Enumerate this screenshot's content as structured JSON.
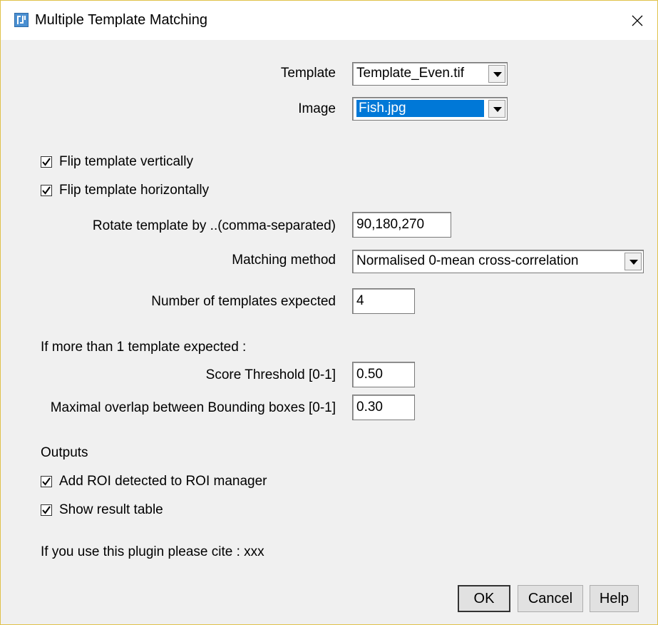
{
  "window": {
    "title": "Multiple Template Matching"
  },
  "fields": {
    "template_label": "Template",
    "template_value": "Template_Even.tif",
    "image_label": "Image",
    "image_value": "Fish.jpg",
    "flip_v_label": "Flip template vertically",
    "flip_v_checked": true,
    "flip_h_label": "Flip template horizontally",
    "flip_h_checked": true,
    "rotate_label": "Rotate template by ..(comma-separated)",
    "rotate_value": "90,180,270",
    "method_label": "Matching method",
    "method_value": "Normalised 0-mean cross-correlation",
    "n_templates_label": "Number of templates expected",
    "n_templates_value": "4",
    "multi_header": "If more than 1 template expected :",
    "score_label": "Score Threshold [0-1]",
    "score_value": "0.50",
    "overlap_label": "Maximal overlap between Bounding boxes [0-1]",
    "overlap_value": "0.30",
    "outputs_header": "Outputs",
    "add_roi_label": "Add ROI detected to ROI manager",
    "add_roi_checked": true,
    "show_table_label": "Show result table",
    "show_table_checked": true,
    "cite_text": "If you use this plugin please cite : xxx"
  },
  "buttons": {
    "ok": "OK",
    "cancel": "Cancel",
    "help": "Help"
  },
  "colors": {
    "selection": "#0078d7",
    "border": "#e0c24a",
    "dialog_bg": "#f0f0f0"
  },
  "icons": {
    "app": "imagej-icon",
    "close": "close-icon",
    "check": "checkmark-icon",
    "dropdown": "chevron-down-icon"
  }
}
